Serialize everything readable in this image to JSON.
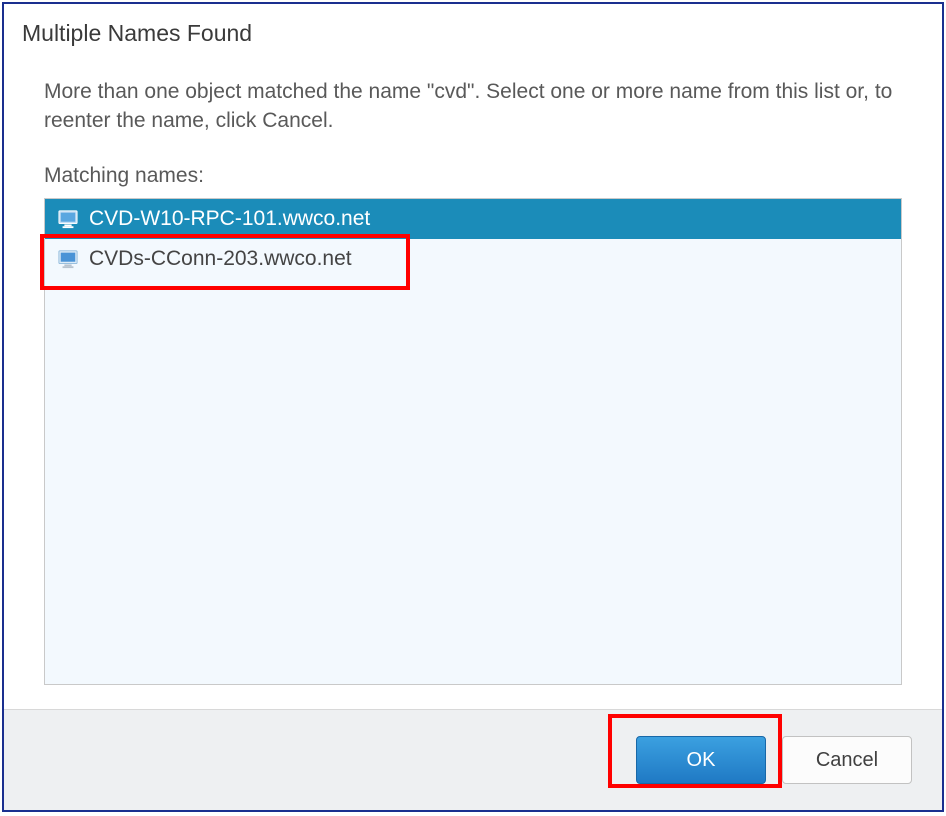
{
  "dialog": {
    "title": "Multiple Names Found",
    "instruction": "More than one object matched the name \"cvd\". Select one or more name from this list or, to reenter the name, click Cancel.",
    "matchingLabel": "Matching names:",
    "items": [
      {
        "name": "CVD-W10-RPC-101.wwco.net",
        "selected": true
      },
      {
        "name": "CVDs-CConn-203.wwco.net",
        "selected": false
      }
    ],
    "buttons": {
      "ok": "OK",
      "cancel": "Cancel"
    }
  }
}
